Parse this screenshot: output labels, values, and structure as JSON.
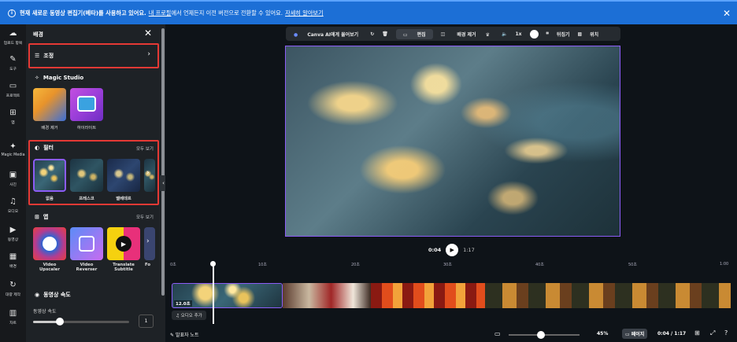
{
  "banner": {
    "icon": "info-icon",
    "text": "현재 새로운 동영상 편집기(베타)를 사용하고 있어요.",
    "link1": "내 프로필",
    "text2": "에서 언제든지 이전 버전으로 전환할 수 있어요.",
    "link2": "자세히 알아보기",
    "close": "✕",
    "color": "#1c6fd6"
  },
  "rail": [
    {
      "label": "업로드 항목",
      "icon": "☁"
    },
    {
      "label": "도구",
      "icon": "✎"
    },
    {
      "label": "프로젝트",
      "icon": "▭"
    },
    {
      "label": "앱",
      "icon": "⊞"
    },
    {
      "label": "Magic Media",
      "icon": "✦"
    },
    {
      "label": "사진",
      "icon": "▣"
    },
    {
      "label": "오디오",
      "icon": "♫"
    },
    {
      "label": "동영상",
      "icon": "▶"
    },
    {
      "label": "배경",
      "icon": "▦"
    },
    {
      "label": "대량 제작",
      "icon": "↻"
    },
    {
      "label": "차트",
      "icon": "▥"
    }
  ],
  "panel": {
    "title": "배경",
    "adjust": "조정",
    "magic_studio": "Magic Studio",
    "magic_items": [
      {
        "label": "배경 제거"
      },
      {
        "label": "하이라이트"
      }
    ],
    "filter": {
      "title": "필터",
      "see_all": "모두 보기",
      "items": [
        "없음",
        "프레스코",
        "벨베데르"
      ]
    },
    "apps": {
      "title": "앱",
      "see_all": "모두 보기",
      "items": [
        {
          "label": "Video\nUpscaler"
        },
        {
          "label": "Video\nReverser"
        },
        {
          "label": "Translate\nSubtitle"
        },
        {
          "label": "Fo"
        }
      ]
    },
    "speed": {
      "title": "동영상 속도",
      "subtitle": "동영상 속도",
      "value": "1",
      "slider_fraction": 0.28
    }
  },
  "toolbar": {
    "ask_canva": "Canva AI에게 물어보기",
    "edit": "편집",
    "bg_remove": "배경 제거",
    "speed": "1x",
    "flip": "뒤집기",
    "position": "위치"
  },
  "player": {
    "current": "0:04",
    "duration": "1:17"
  },
  "ruler": [
    {
      "label": "0초"
    },
    {
      "label": "10초"
    },
    {
      "label": "20초"
    },
    {
      "label": "30초"
    },
    {
      "label": "40초"
    },
    {
      "label": "50초"
    },
    {
      "label": "1:00"
    }
  ],
  "timeline": {
    "clip_length": "12.0초",
    "add_audio": "오디오 추가"
  },
  "bottom": {
    "notes": "발표자 노트",
    "zoom": "45%",
    "zoom_fraction": 0.45,
    "pages": "페이지",
    "time": "0:04 / 1:17"
  }
}
